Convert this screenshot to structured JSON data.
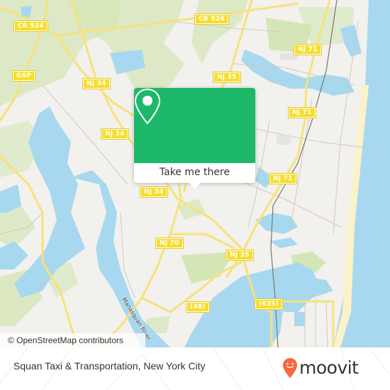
{
  "map": {
    "colors": {
      "land": "#f2f1ed",
      "water": "#a7d8ef",
      "park": "#d4e6b5",
      "road_major": "#f6e27a",
      "road_minor": "#cfcac2",
      "beach": "#fbf2c9",
      "rail": "#777777"
    },
    "road_labels": [
      {
        "id": "cr524-west",
        "text": "CR 524"
      },
      {
        "id": "cr524-east",
        "text": "CR 524"
      },
      {
        "id": "gsp",
        "text": "GSP"
      },
      {
        "id": "nj34-north",
        "text": "NJ 34"
      },
      {
        "id": "nj34-mid",
        "text": "NJ 34"
      },
      {
        "id": "nj34-south",
        "text": "NJ 34"
      },
      {
        "id": "nj35-north",
        "text": "NJ 35"
      },
      {
        "id": "nj35-south",
        "text": "NJ 35"
      },
      {
        "id": "nj71-north",
        "text": "NJ 71"
      },
      {
        "id": "nj71-mid",
        "text": "NJ 71"
      },
      {
        "id": "nj71-south",
        "text": "NJ 71"
      },
      {
        "id": "nj70",
        "text": "NJ 70"
      },
      {
        "id": "r48",
        "text": "(48)"
      },
      {
        "id": "r635",
        "text": "(635)"
      }
    ],
    "water_label": "Manasquan River",
    "attribution": "© OpenStreetMap contributors"
  },
  "popup": {
    "icon": "map-pin-icon",
    "button_label": "Take me there",
    "accent_color": "#1db869"
  },
  "footer": {
    "title": "Squan Taxi & Transportation, New York City",
    "logo_text": "moovit",
    "logo_color": "#f26a3d"
  }
}
